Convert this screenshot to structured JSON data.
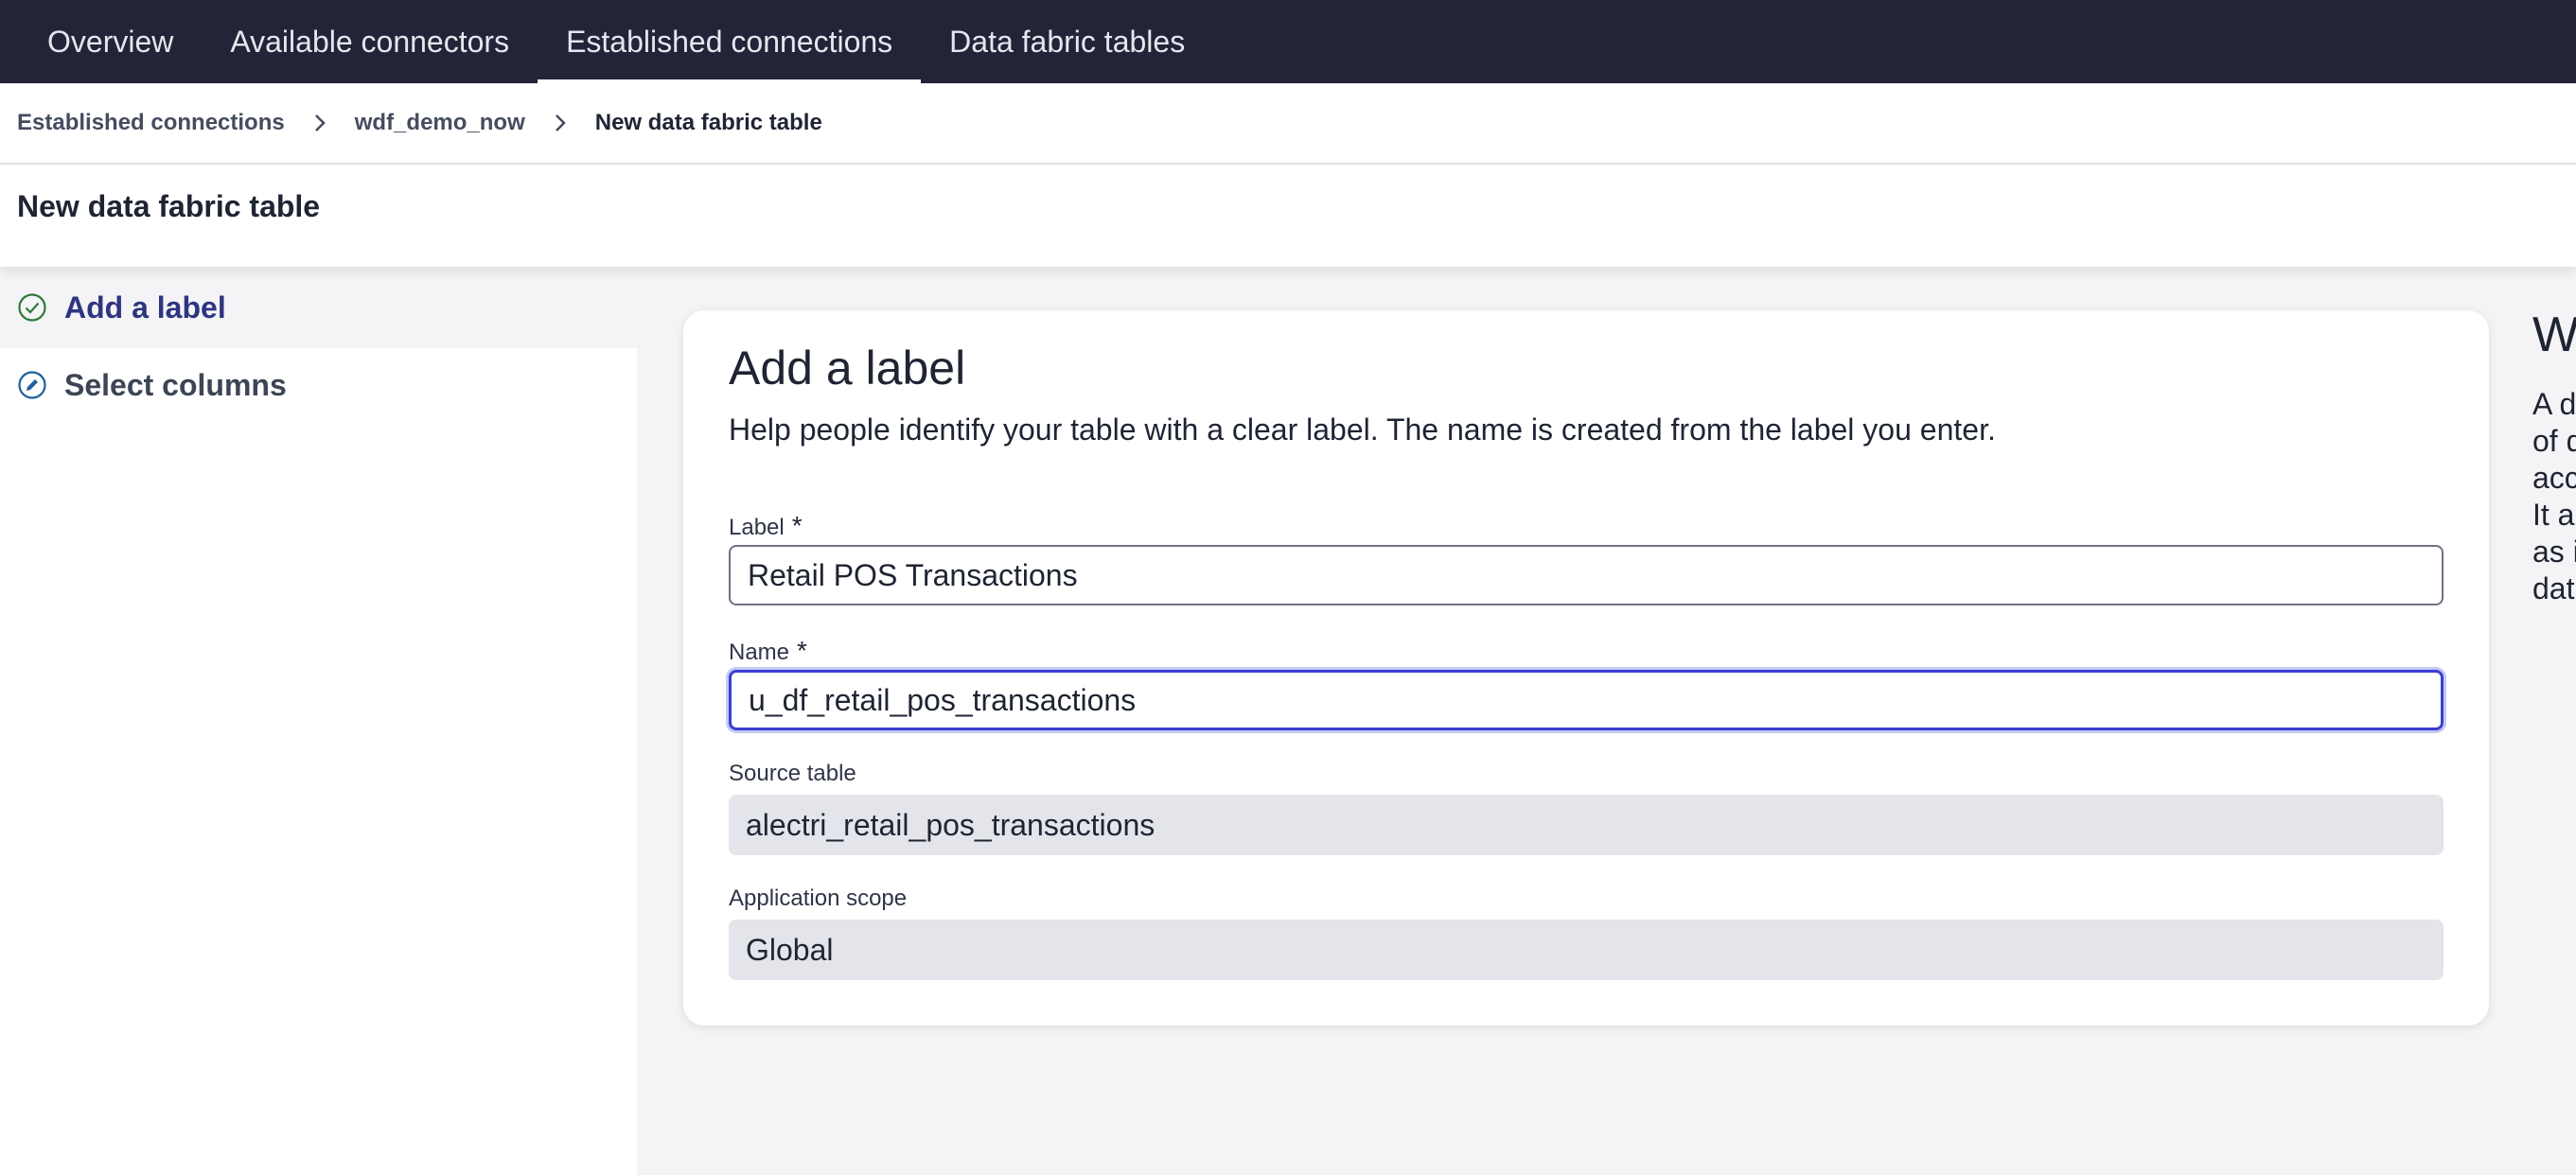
{
  "nav": {
    "tabs": [
      {
        "label": "Overview"
      },
      {
        "label": "Available connectors"
      },
      {
        "label": "Established connections"
      },
      {
        "label": "Data fabric tables"
      }
    ],
    "active_tab": "Established connections"
  },
  "breadcrumb": {
    "items": [
      "Established connections",
      "wdf_demo_now",
      "New data fabric table"
    ]
  },
  "page": {
    "title": "New data fabric table"
  },
  "sidebar": {
    "steps": [
      {
        "label": "Add a label",
        "icon": "check-circle-icon",
        "state": "active"
      },
      {
        "label": "Select columns",
        "icon": "edit-circle-icon",
        "state": "next"
      }
    ]
  },
  "form": {
    "title": "Add a label",
    "description": "Help people identify your table with a clear label. The name is created from the label you enter.",
    "required_mark": "*",
    "label_field": {
      "label": "Label",
      "value": "Retail POS Transactions"
    },
    "name_field": {
      "label": "Name",
      "value": "u_df_retail_pos_transactions"
    },
    "source_table": {
      "label": "Source table",
      "value": "alectri_retail_pos_transactions"
    },
    "application_scope": {
      "label": "Application scope",
      "value": "Global"
    }
  },
  "help_panel": {
    "title_fragment": "W",
    "text_fragments": [
      "A d",
      "of d",
      "acc",
      "It a",
      "as i",
      "dat"
    ]
  },
  "colors": {
    "nav_bg": "#232438",
    "active_step_text": "#2e3580",
    "focus_border": "#3b3fd1",
    "readonly_bg": "#e4e5ea"
  }
}
